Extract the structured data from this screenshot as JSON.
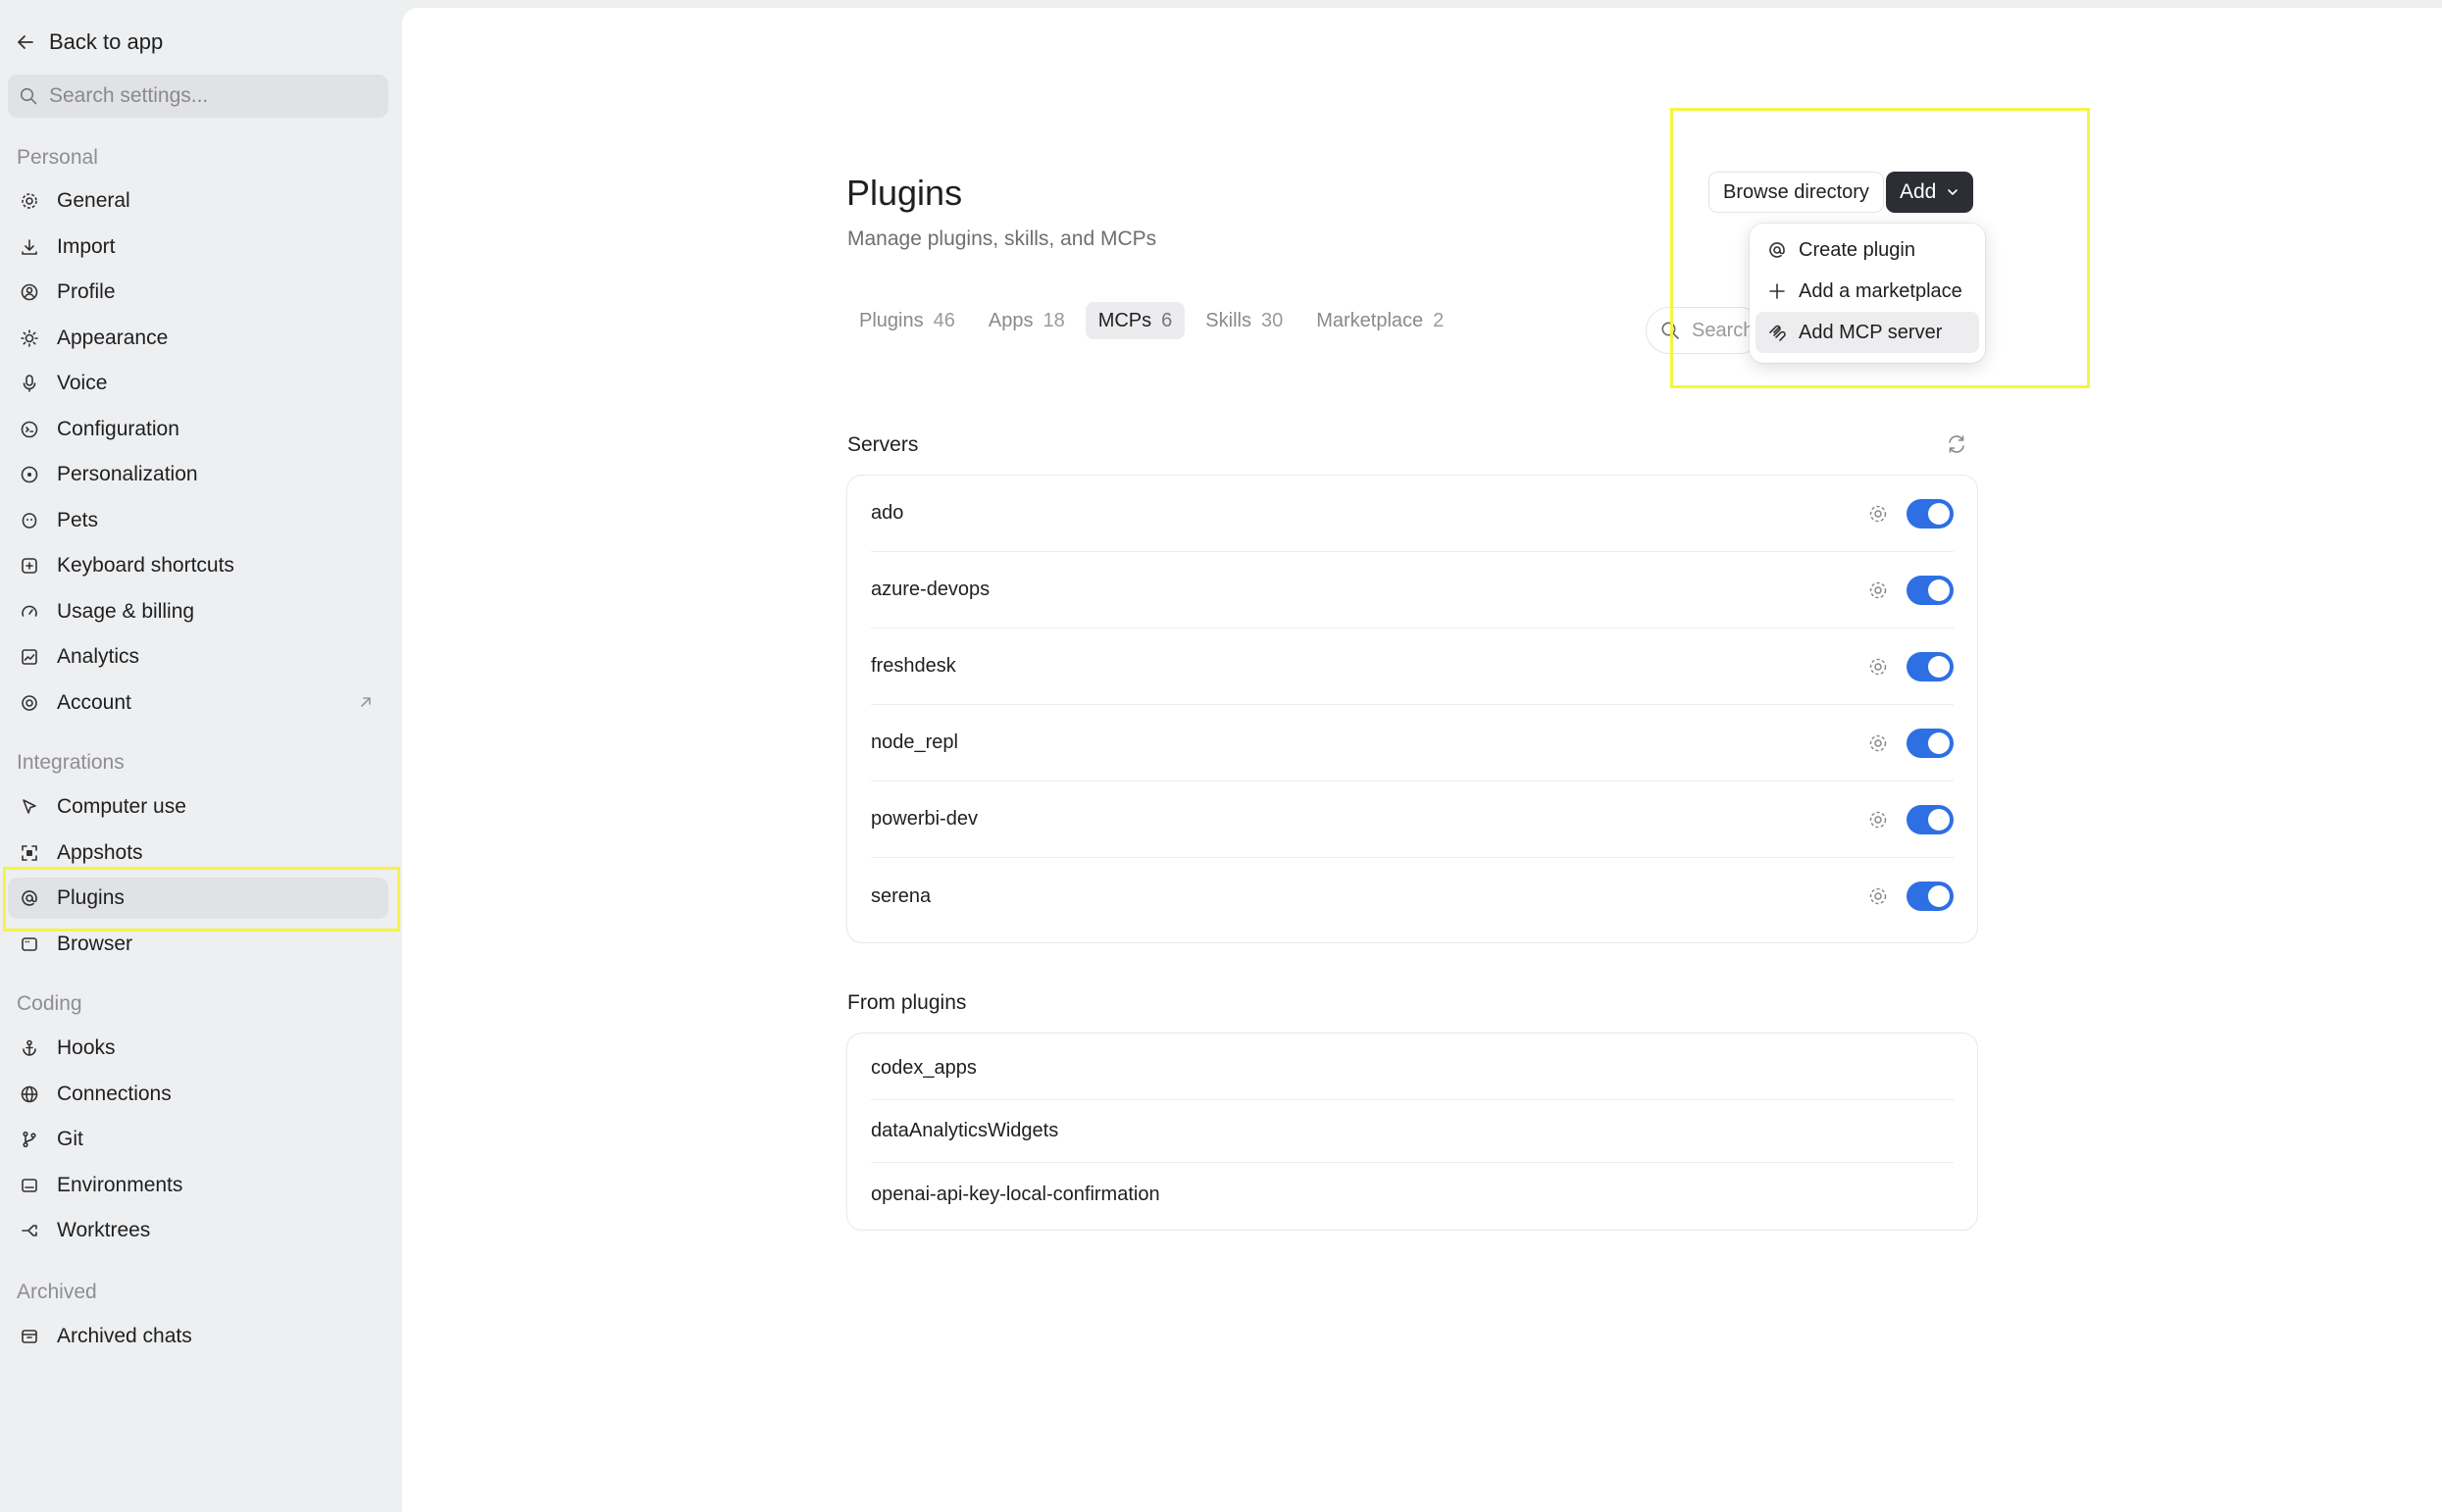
{
  "sidebar": {
    "back_label": "Back to app",
    "search_placeholder": "Search settings...",
    "sections": {
      "personal": "Personal",
      "integrations": "Integrations",
      "coding": "Coding",
      "archived": "Archived"
    },
    "items": {
      "general": "General",
      "import": "Import",
      "profile": "Profile",
      "appearance": "Appearance",
      "voice": "Voice",
      "configuration": "Configuration",
      "personalization": "Personalization",
      "pets": "Pets",
      "keyboard_shortcuts": "Keyboard shortcuts",
      "usage_billing": "Usage & billing",
      "analytics": "Analytics",
      "account": "Account",
      "computer_use": "Computer use",
      "appshots": "Appshots",
      "plugins": "Plugins",
      "browser": "Browser",
      "hooks": "Hooks",
      "connections": "Connections",
      "git": "Git",
      "environments": "Environments",
      "worktrees": "Worktrees",
      "archived_chats": "Archived chats"
    },
    "active_item": "plugins"
  },
  "main": {
    "title": "Plugins",
    "subtitle": "Manage plugins, skills, and MCPs",
    "browse_label": "Browse directory",
    "add_label": "Add",
    "search_placeholder": "Search",
    "tabs": [
      {
        "label": "Plugins",
        "count": "46"
      },
      {
        "label": "Apps",
        "count": "18"
      },
      {
        "label": "MCPs",
        "count": "6"
      },
      {
        "label": "Skills",
        "count": "30"
      },
      {
        "label": "Marketplace",
        "count": "2"
      }
    ],
    "active_tab": "MCPs",
    "dropdown": {
      "items": [
        "Create plugin",
        "Add a marketplace",
        "Add MCP server"
      ],
      "hovered": "Add MCP server"
    },
    "servers_label": "Servers",
    "servers": [
      {
        "name": "ado",
        "enabled": true
      },
      {
        "name": "azure-devops",
        "enabled": true
      },
      {
        "name": "freshdesk",
        "enabled": true
      },
      {
        "name": "node_repl",
        "enabled": true
      },
      {
        "name": "powerbi-dev",
        "enabled": true
      },
      {
        "name": "serena",
        "enabled": true
      }
    ],
    "from_plugins_label": "From plugins",
    "from_plugins": [
      "codex_apps",
      "dataAnalyticsWidgets",
      "openai-api-key-local-confirmation"
    ]
  },
  "colors": {
    "toggle_on": "#2f6fe4",
    "highlight": "#f5f542",
    "add_button": "#2b2e33"
  }
}
